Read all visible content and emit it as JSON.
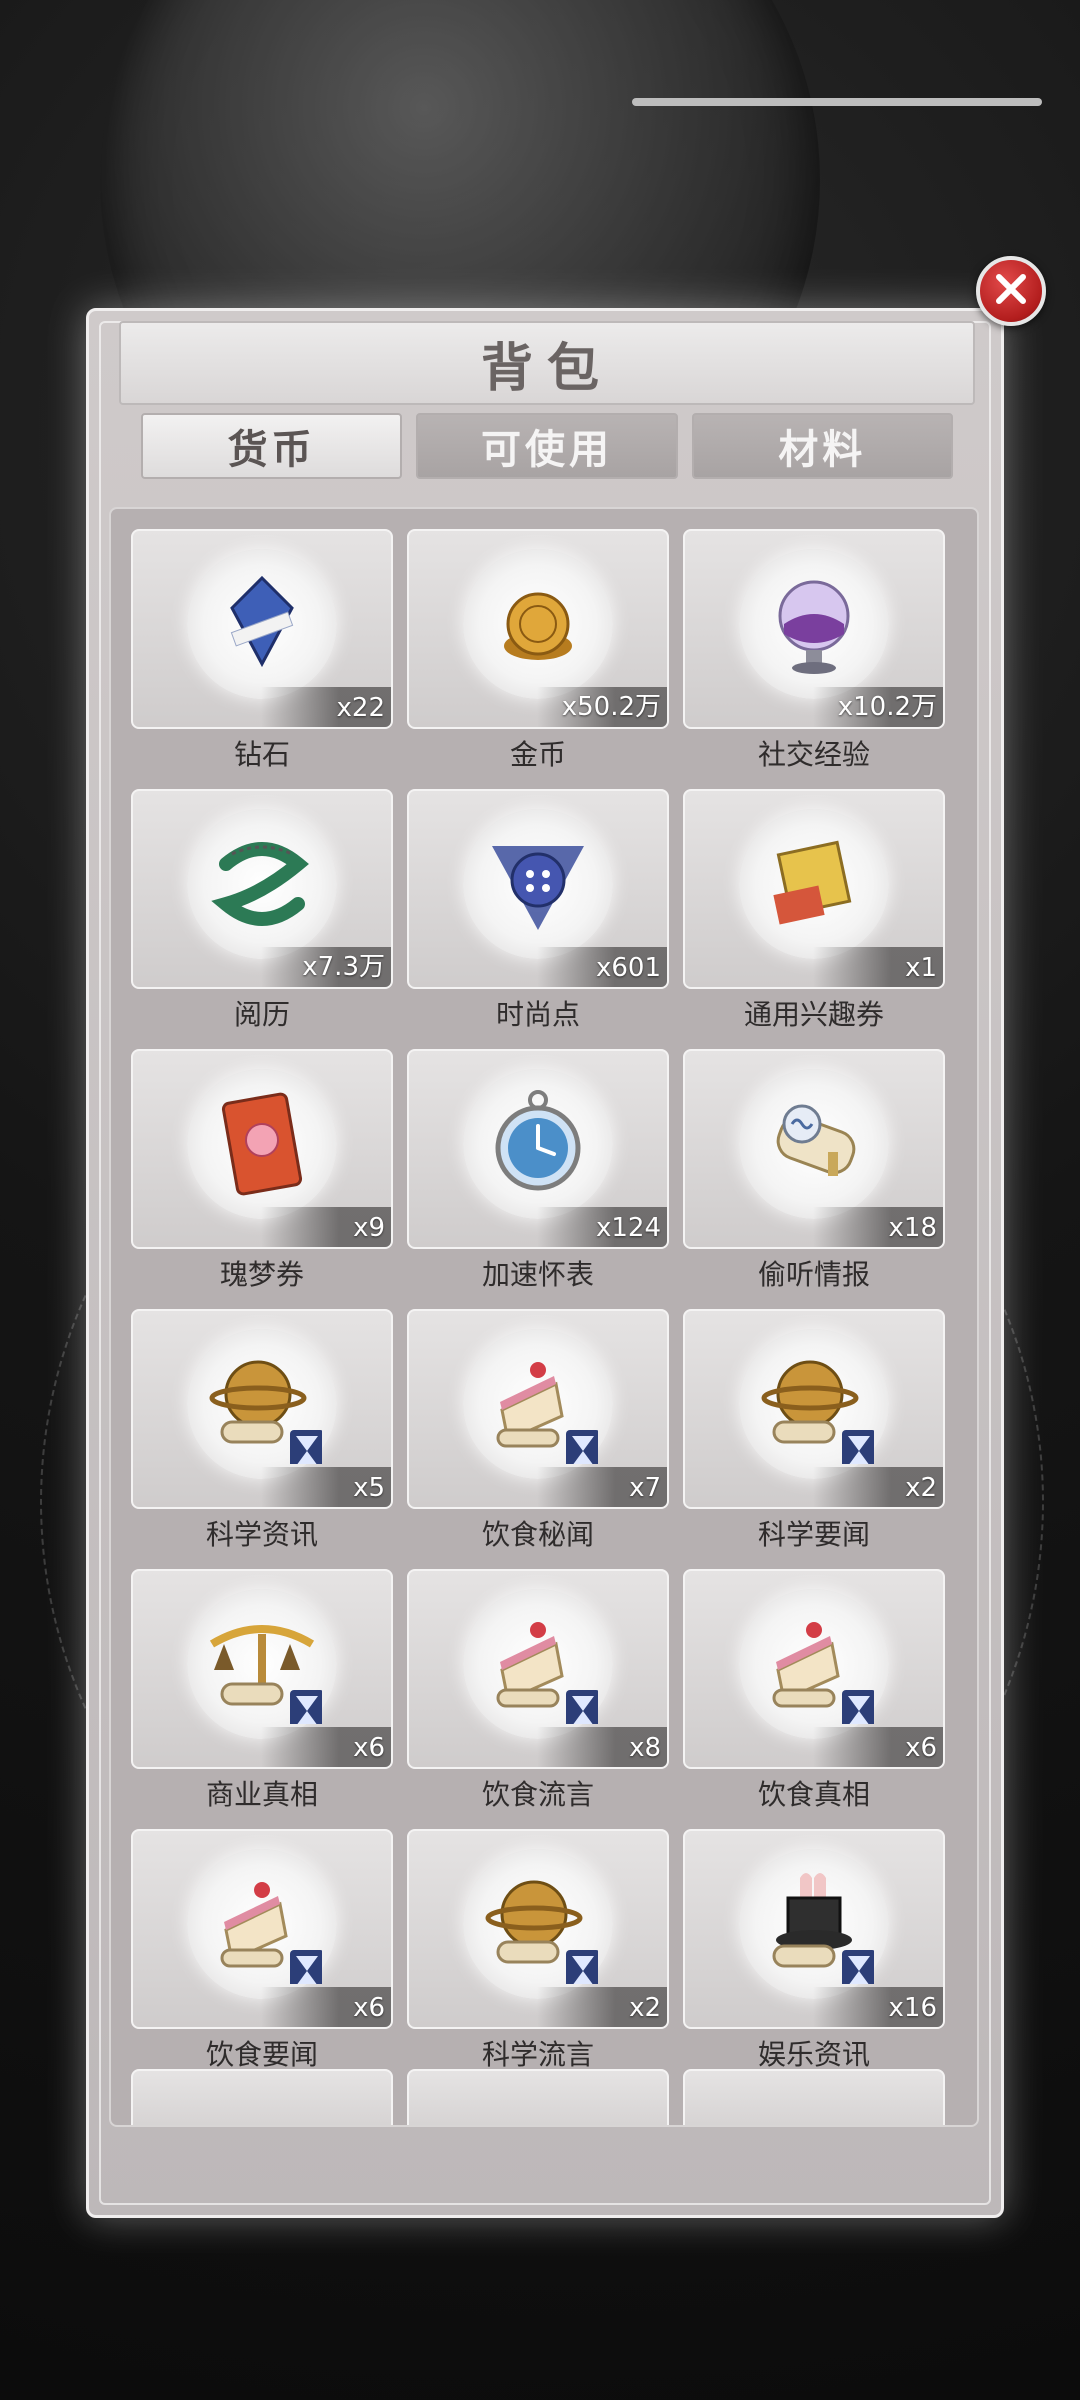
{
  "panel": {
    "title": "背包",
    "tabs": [
      {
        "label": "货币",
        "active": true
      },
      {
        "label": "可使用",
        "active": false
      },
      {
        "label": "材料",
        "active": false
      }
    ]
  },
  "items": [
    {
      "name": "钻石",
      "qty": "x22",
      "icon": "diamond-icon",
      "color": "#3e5fb7"
    },
    {
      "name": "金币",
      "qty": "x50.2万",
      "icon": "gold-coin-icon",
      "color": "#e0a73a"
    },
    {
      "name": "社交经验",
      "qty": "x10.2万",
      "icon": "potion-globe-icon",
      "color": "#7a3f9e"
    },
    {
      "name": "阅历",
      "qty": "x7.3万",
      "icon": "serpent-icon",
      "color": "#2c7a55"
    },
    {
      "name": "时尚点",
      "qty": "x601",
      "icon": "button-icon",
      "color": "#4556b0"
    },
    {
      "name": "通用兴趣券",
      "qty": "x1",
      "icon": "ticket-icon",
      "color": "#d5563b"
    },
    {
      "name": "瑰梦券",
      "qty": "x9",
      "icon": "rose-card-icon",
      "color": "#d9532f"
    },
    {
      "name": "加速怀表",
      "qty": "x124",
      "icon": "pocket-watch-icon",
      "color": "#4b8fc9"
    },
    {
      "name": "偷听情报",
      "qty": "x18",
      "icon": "scroll-icon",
      "color": "#c9a85a"
    },
    {
      "name": "科学资讯",
      "qty": "x5",
      "icon": "globe-hourglass-icon",
      "color": "#c9953a"
    },
    {
      "name": "饮食秘闻",
      "qty": "x7",
      "icon": "cake-hourglass-icon",
      "color": "#e08ca2"
    },
    {
      "name": "科学要闻",
      "qty": "x2",
      "icon": "globe-hourglass-icon",
      "color": "#c9953a"
    },
    {
      "name": "商业真相",
      "qty": "x6",
      "icon": "scales-hourglass-icon",
      "color": "#b98b3a"
    },
    {
      "name": "饮食流言",
      "qty": "x8",
      "icon": "cake-hourglass-icon",
      "color": "#e08ca2"
    },
    {
      "name": "饮食真相",
      "qty": "x6",
      "icon": "cake-hourglass-icon",
      "color": "#e08ca2"
    },
    {
      "name": "饮食要闻",
      "qty": "x6",
      "icon": "cake-hourglass-icon",
      "color": "#e08ca2"
    },
    {
      "name": "科学流言",
      "qty": "x2",
      "icon": "globe-hourglass-icon",
      "color": "#c9953a"
    },
    {
      "name": "娱乐资讯",
      "qty": "x16",
      "icon": "magic-hat-hourglass-icon",
      "color": "#2f2f2f"
    }
  ]
}
